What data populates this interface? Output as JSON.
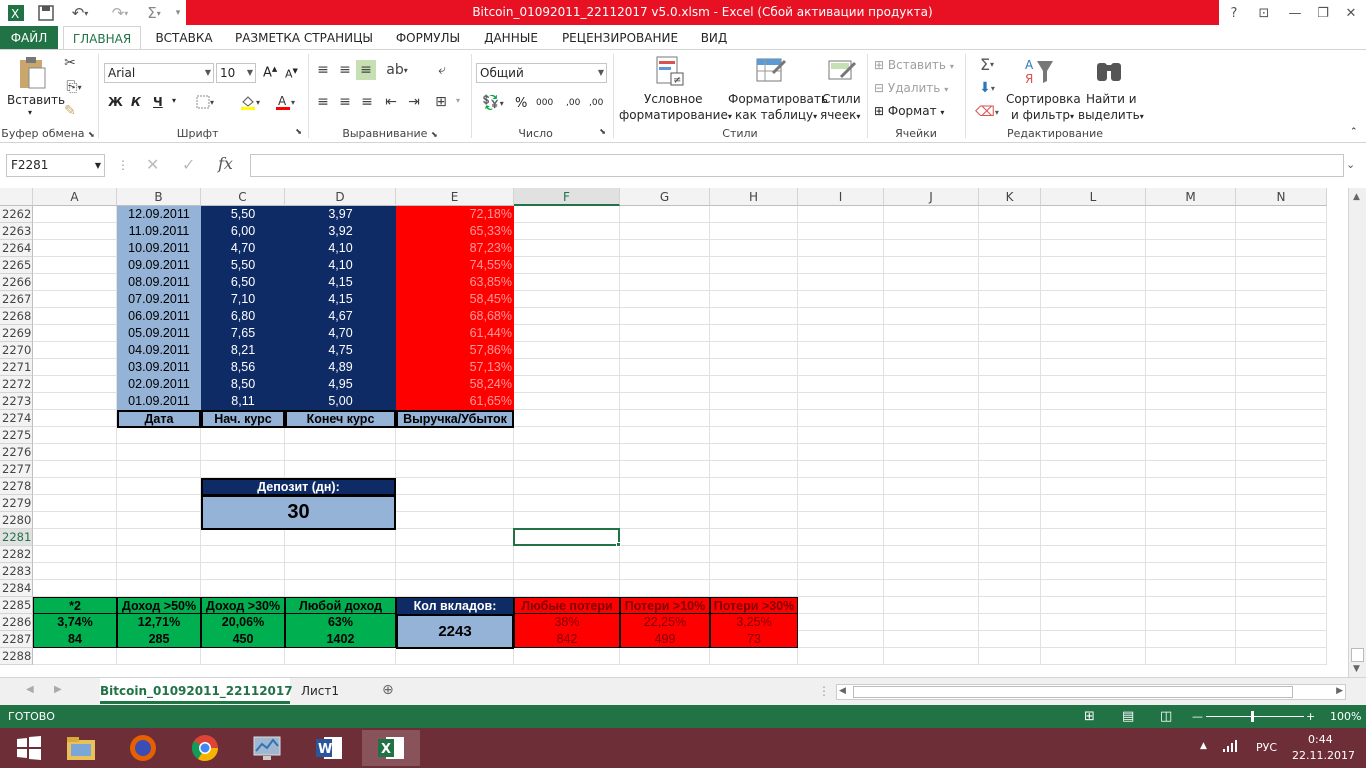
{
  "window": {
    "title": "Bitcoin_01092011_22112017 v5.0.xlsm -  Excel (Сбой активации продукта)"
  },
  "qat": {
    "save_icon": "save-icon",
    "undo_icon": "undo-icon",
    "redo_icon": "redo-icon",
    "sum_icon": "autosum-icon"
  },
  "titlebar_buttons": {
    "help": "?",
    "restore": "⊡",
    "minimize": "—",
    "maximize": "❐",
    "close": "✕"
  },
  "tabs": [
    "ФАЙЛ",
    "ГЛАВНАЯ",
    "ВСТАВКА",
    "РАЗМЕТКА СТРАНИЦЫ",
    "ФОРМУЛЫ",
    "ДАННЫЕ",
    "РЕЦЕНЗИРОВАНИЕ",
    "ВИД"
  ],
  "ribbon": {
    "clipboard": {
      "paste": "Вставить",
      "label": "Буфер обмена"
    },
    "font": {
      "name": "Arial",
      "size": "10",
      "bold": "Ж",
      "italic": "К",
      "underline": "Ч",
      "grow": "A",
      "shrink": "A",
      "label": "Шрифт"
    },
    "alignment": {
      "label": "Выравнивание"
    },
    "number": {
      "format": "Общий",
      "percent": "%",
      "thousands": "000",
      "inc_dec": ",00",
      "dec_dec": ",00",
      "label": "Число"
    },
    "styles": {
      "cond1": "Условное",
      "cond2": "форматирование",
      "table1": "Форматировать",
      "table2": "как таблицу",
      "cell1": "Стили",
      "cell2": "ячеек",
      "label": "Стили"
    },
    "cells": {
      "insert": "Вставить",
      "delete": "Удалить",
      "format": "Формат",
      "label": "Ячейки"
    },
    "editing": {
      "sort1": "Сортировка",
      "sort2": "и фильтр",
      "find1": "Найти и",
      "find2": "выделить",
      "label": "Редактирование"
    }
  },
  "formula_bar": {
    "name_box": "F2281",
    "fx": "fx",
    "value": ""
  },
  "columns": [
    "A",
    "B",
    "C",
    "D",
    "E",
    "F",
    "G",
    "H",
    "I",
    "J",
    "K",
    "L",
    "M",
    "N"
  ],
  "rows": [
    "2262",
    "2263",
    "2264",
    "2265",
    "2266",
    "2267",
    "2268",
    "2269",
    "2270",
    "2271",
    "2272",
    "2273",
    "2274",
    "2275",
    "2276",
    "2277",
    "2278",
    "2279",
    "2280",
    "2281",
    "2282",
    "2283",
    "2284",
    "2285",
    "2286",
    "2287",
    "2288"
  ],
  "data_rows": [
    {
      "date": "12.09.2011",
      "start": "5,50",
      "end": "3,97",
      "pnl": "72,18%"
    },
    {
      "date": "11.09.2011",
      "start": "6,00",
      "end": "3,92",
      "pnl": "65,33%"
    },
    {
      "date": "10.09.2011",
      "start": "4,70",
      "end": "4,10",
      "pnl": "87,23%"
    },
    {
      "date": "09.09.2011",
      "start": "5,50",
      "end": "4,10",
      "pnl": "74,55%"
    },
    {
      "date": "08.09.2011",
      "start": "6,50",
      "end": "4,15",
      "pnl": "63,85%"
    },
    {
      "date": "07.09.2011",
      "start": "7,10",
      "end": "4,15",
      "pnl": "58,45%"
    },
    {
      "date": "06.09.2011",
      "start": "6,80",
      "end": "4,67",
      "pnl": "68,68%"
    },
    {
      "date": "05.09.2011",
      "start": "7,65",
      "end": "4,70",
      "pnl": "61,44%"
    },
    {
      "date": "04.09.2011",
      "start": "8,21",
      "end": "4,75",
      "pnl": "57,86%"
    },
    {
      "date": "03.09.2011",
      "start": "8,56",
      "end": "4,89",
      "pnl": "57,13%"
    },
    {
      "date": "02.09.2011",
      "start": "8,50",
      "end": "4,95",
      "pnl": "58,24%"
    },
    {
      "date": "01.09.2011",
      "start": "8,11",
      "end": "5,00",
      "pnl": "61,65%"
    }
  ],
  "headers": {
    "date": "Дата",
    "start": "Нач. курс",
    "end": "Конеч курс",
    "pnl": "Выручка/Убыток"
  },
  "deposit": {
    "label": "Депозит (дн):",
    "value": "30"
  },
  "summary": {
    "green_headers": [
      "*2",
      "Доход >50%",
      "Доход >30%",
      "Любой доход"
    ],
    "green_pct": [
      "3,74%",
      "12,71%",
      "20,06%",
      "63%"
    ],
    "green_cnt": [
      "84",
      "285",
      "450",
      "1402"
    ],
    "count_label": "Кол вкладов:",
    "count_value": "2243",
    "red_headers": [
      "Любые потери",
      "Потери >10%",
      "Потери >30%"
    ],
    "red_pct": [
      "38%",
      "22,25%",
      "3,25%"
    ],
    "red_cnt": [
      "842",
      "499",
      "73"
    ]
  },
  "sheets": [
    "Bitcoin_01092011_22112017",
    "Лист1"
  ],
  "status": {
    "ready": "ГОТОВО",
    "zoom": "100%"
  },
  "taskbar": {
    "lang": "РУС",
    "time": "0:44",
    "date": "22.11.2017"
  },
  "colors": {
    "excel_green": "#217346",
    "title_red": "#e81123",
    "navy": "#0f2b66",
    "light_blue": "#95b3d7",
    "green": "#00b050",
    "red": "#ff0000"
  }
}
